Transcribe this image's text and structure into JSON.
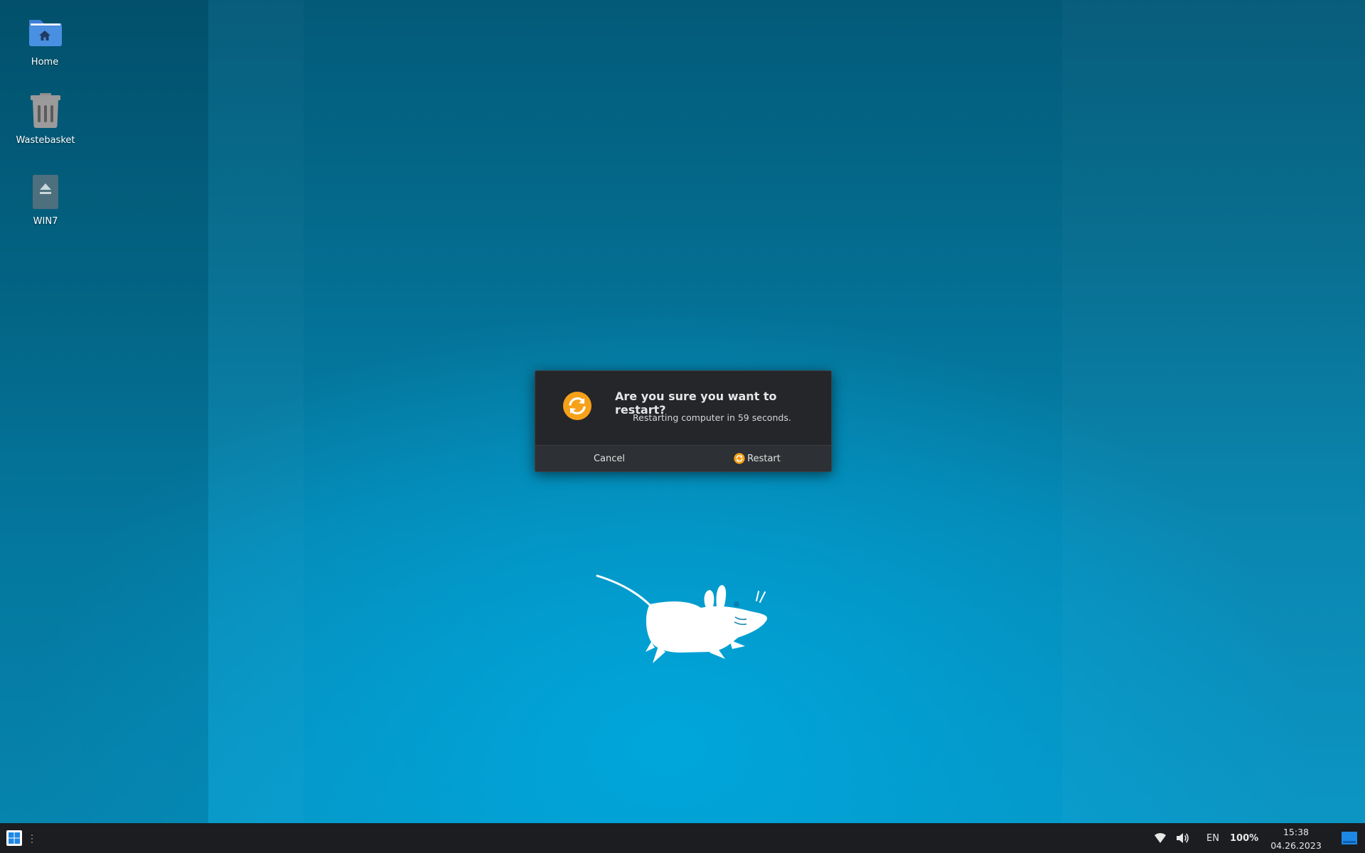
{
  "desktop": {
    "icons": [
      {
        "label": "Home",
        "icon": "folder-home-icon"
      },
      {
        "label": "Wastebasket",
        "icon": "trash-icon"
      },
      {
        "label": "WIN7",
        "icon": "drive-eject-icon"
      }
    ],
    "wallpaper": {
      "mascot": "xfce-mouse-logo",
      "colors": {
        "top": "#035a78",
        "bottom": "#00a6db"
      }
    }
  },
  "dialog": {
    "title": "Are you sure you want to restart?",
    "message": "Restarting computer in 59 seconds.",
    "icon": "restart-icon",
    "buttons": {
      "cancel": "Cancel",
      "restart": "Restart"
    },
    "colors": {
      "background": "#24262a",
      "accent": "#f7a11a"
    }
  },
  "taskbar": {
    "start_icon": "windows-start-icon",
    "tray": {
      "network_icon": "wifi-icon",
      "volume_icon": "volume-icon",
      "keyboard_layout": "EN",
      "battery": "100%"
    },
    "clock": {
      "time": "15:38",
      "date": "04.26.2023"
    },
    "show_desktop_icon": "show-desktop-icon",
    "colors": {
      "background": "#1b1d20",
      "accent": "#1e88e5"
    }
  }
}
